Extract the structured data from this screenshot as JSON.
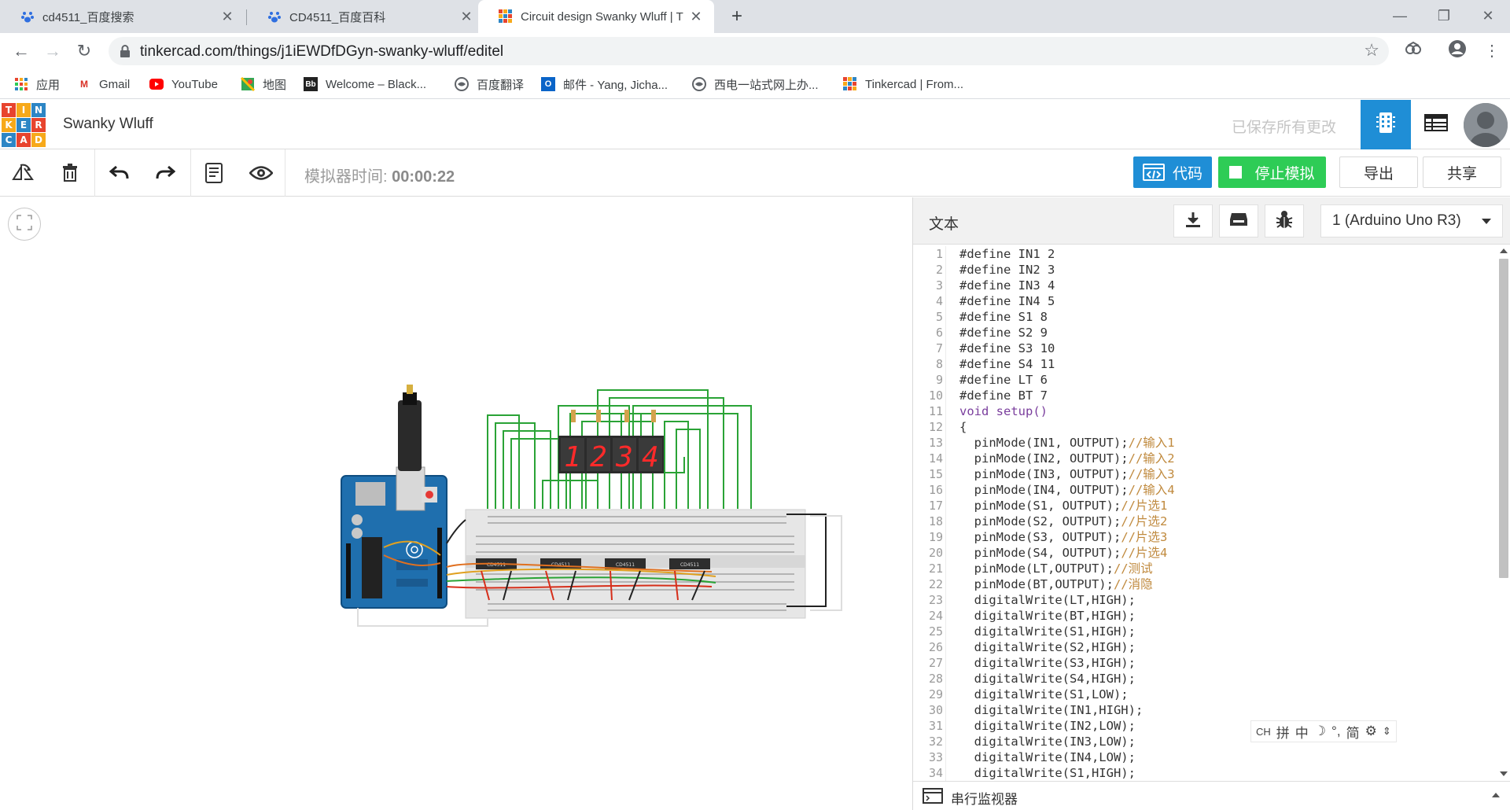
{
  "browser": {
    "tabs": [
      {
        "title": "cd4511_百度搜索",
        "icon": "baidu-paw-icon"
      },
      {
        "title": "CD4511_百度百科",
        "icon": "baidu-paw-icon"
      },
      {
        "title": "Circuit design Swanky Wluff | T",
        "icon": "tinkercad-icon"
      }
    ],
    "url": "tinkercad.com/things/j1iEWDfDGyn-swanky-wluff/editel",
    "bookmarks": [
      {
        "label": "应用",
        "icon": "apps-grid-icon"
      },
      {
        "label": "Gmail",
        "icon": "gmail-icon"
      },
      {
        "label": "YouTube",
        "icon": "youtube-icon"
      },
      {
        "label": "地图",
        "icon": "maps-icon"
      },
      {
        "label": "Welcome – Black...",
        "icon": "blackboard-icon"
      },
      {
        "label": "百度翻译",
        "icon": "globe-icon"
      },
      {
        "label": "邮件 - Yang, Jicha...",
        "icon": "outlook-icon"
      },
      {
        "label": "西电一站式网上办...",
        "icon": "globe-icon"
      },
      {
        "label": "Tinkercad | From...",
        "icon": "tinkercad-icon"
      }
    ]
  },
  "tinkercad": {
    "logo_letters": [
      "T",
      "I",
      "N",
      "K",
      "E",
      "R",
      "C",
      "A",
      "D"
    ],
    "logo_colors": [
      "#e8442e",
      "#f7a91a",
      "#2d86c5",
      "#f7a91a",
      "#2d86c5",
      "#e8442e",
      "#2d86c5",
      "#e8442e",
      "#f7a91a"
    ],
    "design_name": "Swanky Wluff",
    "saved_status": "已保存所有更改",
    "sim_time_label": "模拟器时间:",
    "sim_time_value": "00:00:22",
    "buttons": {
      "code": "代码",
      "stop": "停止模拟",
      "export": "导出",
      "share": "共享"
    },
    "accent_colors": {
      "code_button": "#1f8ed6",
      "stop_button": "#2ecc56",
      "active_view": "#1f8ed6"
    }
  },
  "code_panel": {
    "mode": "文本",
    "device": "1 (Arduino Uno R3)",
    "serial_monitor": "串行监视器",
    "lines": [
      {
        "n": "1",
        "code": "#define IN1 2",
        "comment": ""
      },
      {
        "n": "2",
        "code": "#define IN2 3",
        "comment": ""
      },
      {
        "n": "3",
        "code": "#define IN3 4",
        "comment": ""
      },
      {
        "n": "4",
        "code": "#define IN4 5",
        "comment": ""
      },
      {
        "n": "5",
        "code": "#define S1 8",
        "comment": ""
      },
      {
        "n": "6",
        "code": "#define S2 9",
        "comment": ""
      },
      {
        "n": "7",
        "code": "#define S3 10",
        "comment": ""
      },
      {
        "n": "8",
        "code": "#define S4 11",
        "comment": ""
      },
      {
        "n": "9",
        "code": "#define LT 6",
        "comment": ""
      },
      {
        "n": "10",
        "code": "#define BT 7",
        "comment": ""
      },
      {
        "n": "11",
        "code": "void setup()",
        "comment": ""
      },
      {
        "n": "12",
        "code": "{",
        "comment": ""
      },
      {
        "n": "13",
        "code": "  pinMode(IN1, OUTPUT);",
        "comment": "//输入1"
      },
      {
        "n": "14",
        "code": "  pinMode(IN2, OUTPUT);",
        "comment": "//输入2"
      },
      {
        "n": "15",
        "code": "  pinMode(IN3, OUTPUT);",
        "comment": "//输入3"
      },
      {
        "n": "16",
        "code": "  pinMode(IN4, OUTPUT);",
        "comment": "//输入4"
      },
      {
        "n": "17",
        "code": "  pinMode(S1, OUTPUT);",
        "comment": "//片选1"
      },
      {
        "n": "18",
        "code": "  pinMode(S2, OUTPUT);",
        "comment": "//片选2"
      },
      {
        "n": "19",
        "code": "  pinMode(S3, OUTPUT);",
        "comment": "//片选3"
      },
      {
        "n": "20",
        "code": "  pinMode(S4, OUTPUT);",
        "comment": "//片选4"
      },
      {
        "n": "21",
        "code": "  pinMode(LT,OUTPUT);",
        "comment": "//测试"
      },
      {
        "n": "22",
        "code": "  pinMode(BT,OUTPUT);",
        "comment": "//消隐"
      },
      {
        "n": "23",
        "code": "  digitalWrite(LT,HIGH);",
        "comment": ""
      },
      {
        "n": "24",
        "code": "  digitalWrite(BT,HIGH);",
        "comment": ""
      },
      {
        "n": "25",
        "code": "  digitalWrite(S1,HIGH);",
        "comment": ""
      },
      {
        "n": "26",
        "code": "  digitalWrite(S2,HIGH);",
        "comment": ""
      },
      {
        "n": "27",
        "code": "  digitalWrite(S3,HIGH);",
        "comment": ""
      },
      {
        "n": "28",
        "code": "  digitalWrite(S4,HIGH);",
        "comment": ""
      },
      {
        "n": "29",
        "code": "  digitalWrite(S1,LOW);",
        "comment": ""
      },
      {
        "n": "30",
        "code": "  digitalWrite(IN1,HIGH);",
        "comment": ""
      },
      {
        "n": "31",
        "code": "  digitalWrite(IN2,LOW);",
        "comment": ""
      },
      {
        "n": "32",
        "code": "  digitalWrite(IN3,LOW);",
        "comment": ""
      },
      {
        "n": "33",
        "code": "  digitalWrite(IN4,LOW);",
        "comment": ""
      },
      {
        "n": "34",
        "code": "  digitalWrite(S1,HIGH);",
        "comment": ""
      }
    ]
  },
  "circuit": {
    "display_digits": [
      "1",
      "2",
      "3",
      "4"
    ],
    "ic_labels": [
      "CD4511",
      "CD4511",
      "CD4511",
      "CD4511"
    ]
  },
  "ime_toolbar": [
    "CH",
    "拼",
    "中",
    "简"
  ]
}
